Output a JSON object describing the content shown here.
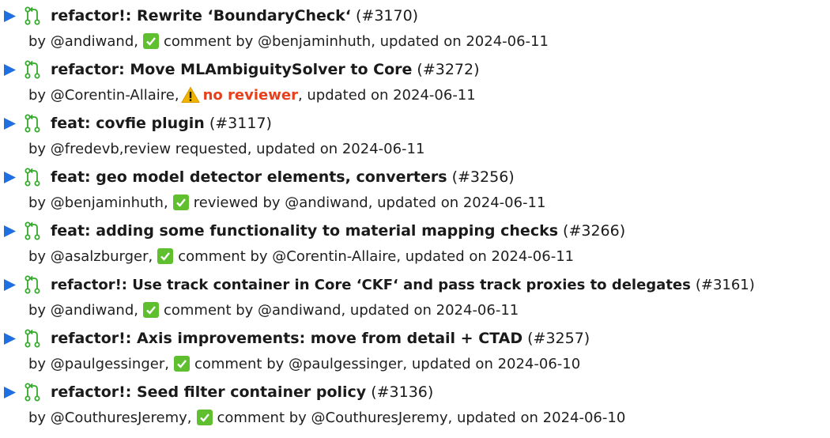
{
  "colors": {
    "arrow": "#1f6fe0",
    "pr_icon": "#36a82d",
    "check_bg": "#5fbf2f",
    "warning": "#f0b400",
    "no_reviewer": "#e6401c"
  },
  "items": [
    {
      "title": "refactor!: Rewrite ‘BoundaryCheck‘",
      "number": "(#3170)",
      "by": "by @andiwand,",
      "status_icon": "check-icon",
      "status_text": "comment by @benjaminhuth, updated on 2024-06-11"
    },
    {
      "title": "refactor: Move MLAmbiguitySolver to Core",
      "number": "(#3272)",
      "by": "by @Corentin-Allaire,",
      "status_icon": "warning-icon",
      "status_alert": "no reviewer",
      "status_text": ", updated on 2024-06-11"
    },
    {
      "title": "feat: covfie plugin",
      "number": "(#3117)",
      "by": "by @fredevb,review requested, updated on 2024-06-11"
    },
    {
      "title": "feat: geo model detector elements, converters",
      "number": "(#3256)",
      "by": "by @benjaminhuth,",
      "status_icon": "check-icon",
      "status_text": "reviewed by @andiwand, updated on 2024-06-11"
    },
    {
      "title": "feat: adding some functionality to material mapping checks",
      "number": "(#3266)",
      "by": "by @asalzburger,",
      "status_icon": "check-icon",
      "status_text": "comment by @Corentin-Allaire, updated on 2024-06-11"
    },
    {
      "title": "refactor!: Use track container in Core ‘CKF‘ and pass track proxies to delegates",
      "number": "(#3161)",
      "by": "by @andiwand,",
      "status_icon": "check-icon",
      "status_text": "comment by @andiwand, updated on 2024-06-11"
    },
    {
      "title": "refactor!: Axis improvements: move from detail + CTAD",
      "number": "(#3257)",
      "by": "by @paulgessinger,",
      "status_icon": "check-icon",
      "status_text": "comment by @paulgessinger, updated on 2024-06-10"
    },
    {
      "title": "refactor!: Seed filter container policy",
      "number": "(#3136)",
      "by": "by @CouthuresJeremy,",
      "status_icon": "check-icon",
      "status_text": "comment by @CouthuresJeremy, updated on 2024-06-10"
    }
  ]
}
